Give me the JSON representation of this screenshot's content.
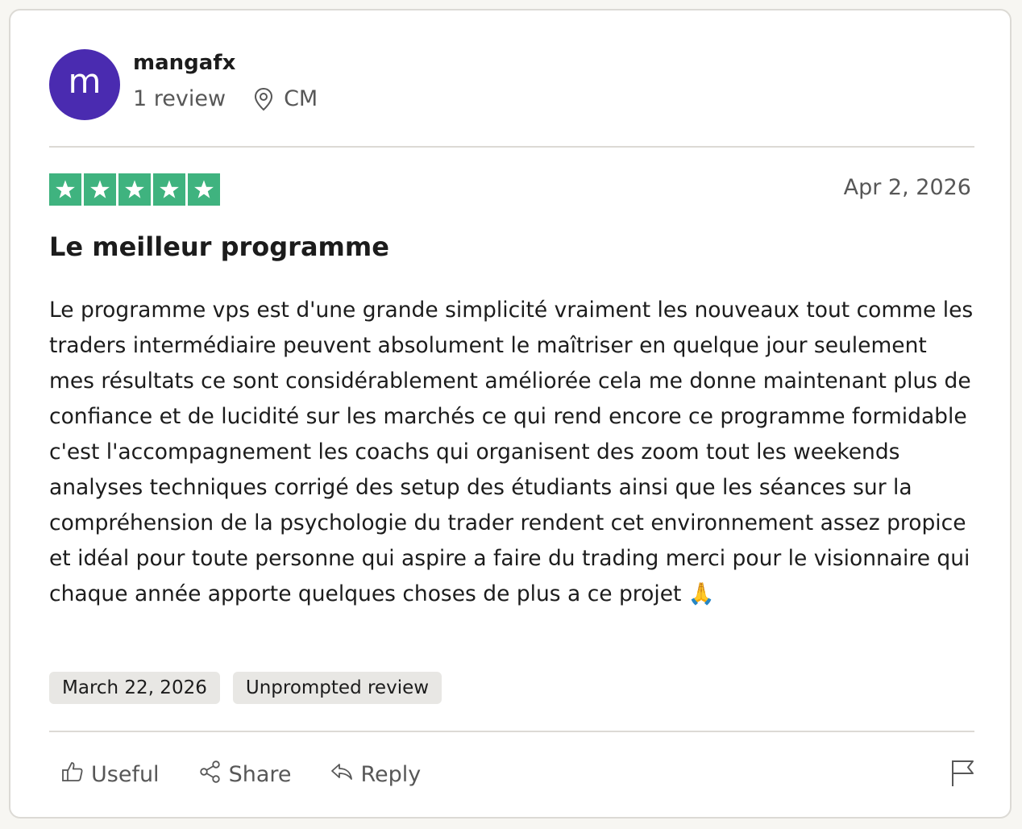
{
  "reviewer": {
    "avatar_letter": "m",
    "avatar_color": "#4a2bb0",
    "name": "mangafx",
    "review_count": "1 review",
    "country": "CM"
  },
  "review": {
    "rating": 5,
    "star_color": "#3fb37f",
    "date": "Apr 2, 2026",
    "title": "Le meilleur programme",
    "body": "Le programme vps est d'une grande simplicité vraiment les nouveaux tout comme les traders intermédiaire peuvent absolument le maîtriser en quelque jour seulement mes résultats ce sont considérablement améliorée cela me donne maintenant plus de confiance et de lucidité sur les marchés ce qui rend encore ce programme formidable c'est l'accompagnement les coachs qui organisent des zoom tout les weekends analyses techniques corrigé des setup des étudiants ainsi que les séances sur la compréhension de la psychologie du trader rendent cet environnement assez propice et idéal pour toute personne qui aspire a faire du trading  merci pour le visionnaire qui chaque année apporte quelques choses de plus a ce projet 🙏",
    "experience_date": "March 22, 2026",
    "review_type": "Unprompted review"
  },
  "actions": {
    "useful": "Useful",
    "share": "Share",
    "reply": "Reply"
  },
  "icons": {
    "location": "map-pin-icon",
    "useful": "thumbs-up-icon",
    "share": "share-icon",
    "reply": "reply-icon",
    "report": "flag-icon"
  }
}
